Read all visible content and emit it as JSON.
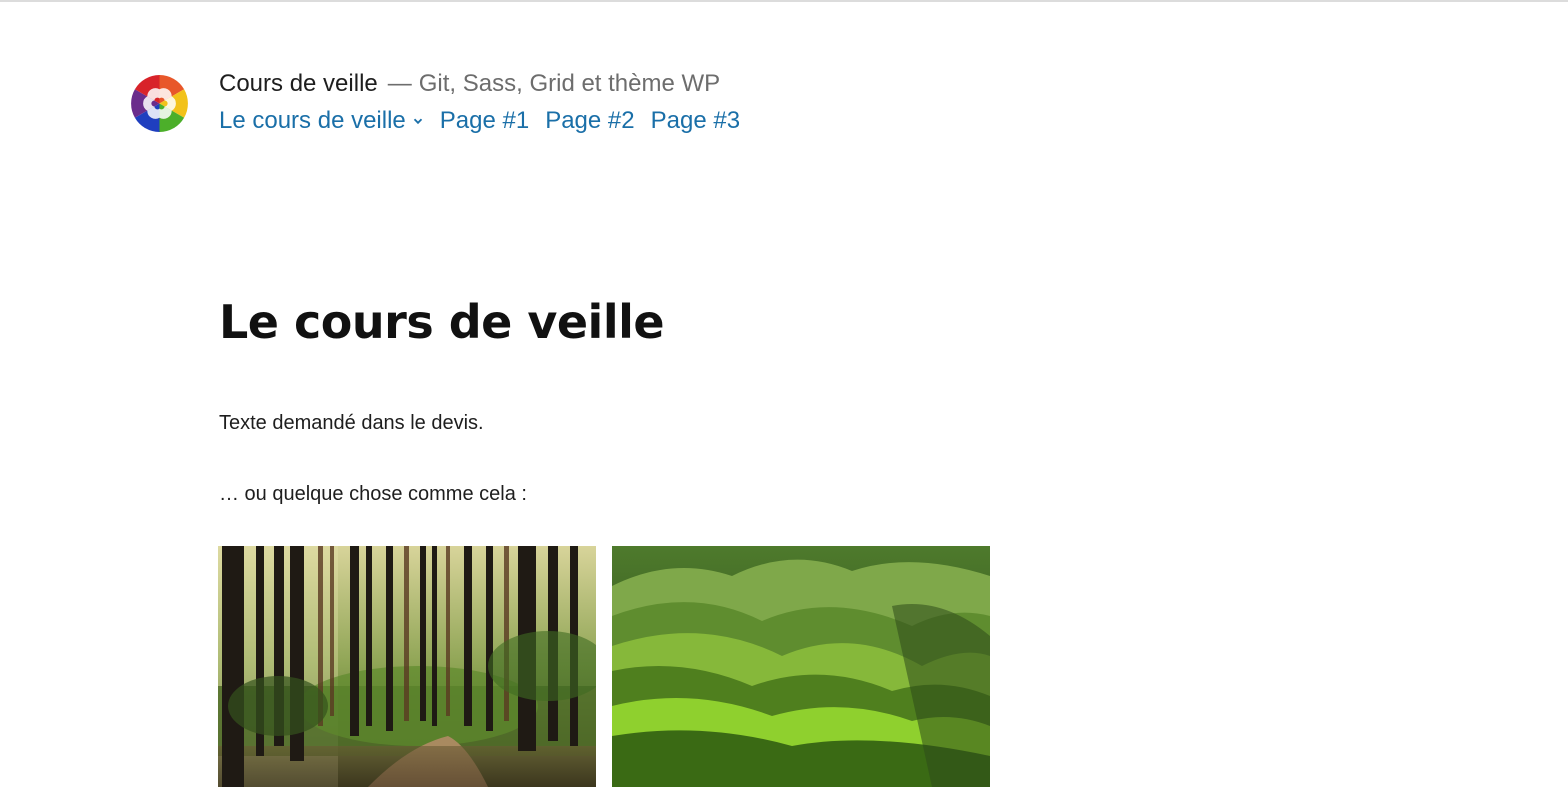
{
  "header": {
    "site_title": "Cours de veille",
    "separator": "—",
    "site_description": "Git, Sass, Grid et thème WP",
    "logo_icon": "swirl-logo-icon"
  },
  "nav": {
    "items": [
      {
        "label": "Le cours de veille",
        "has_submenu": true
      },
      {
        "label": "Page #1"
      },
      {
        "label": "Page #2"
      },
      {
        "label": "Page #3"
      }
    ]
  },
  "main": {
    "title": "Le cours de veille",
    "paragraphs": [
      "Texte demandé dans le devis.",
      "… ou quelque chose comme cela :"
    ],
    "gallery": [
      {
        "subject": "forest-photo"
      },
      {
        "subject": "green-hills-photo"
      }
    ]
  },
  "colors": {
    "link": "#1a6fa8",
    "text": "#1e1e1e",
    "muted": "#6d6d6d"
  }
}
